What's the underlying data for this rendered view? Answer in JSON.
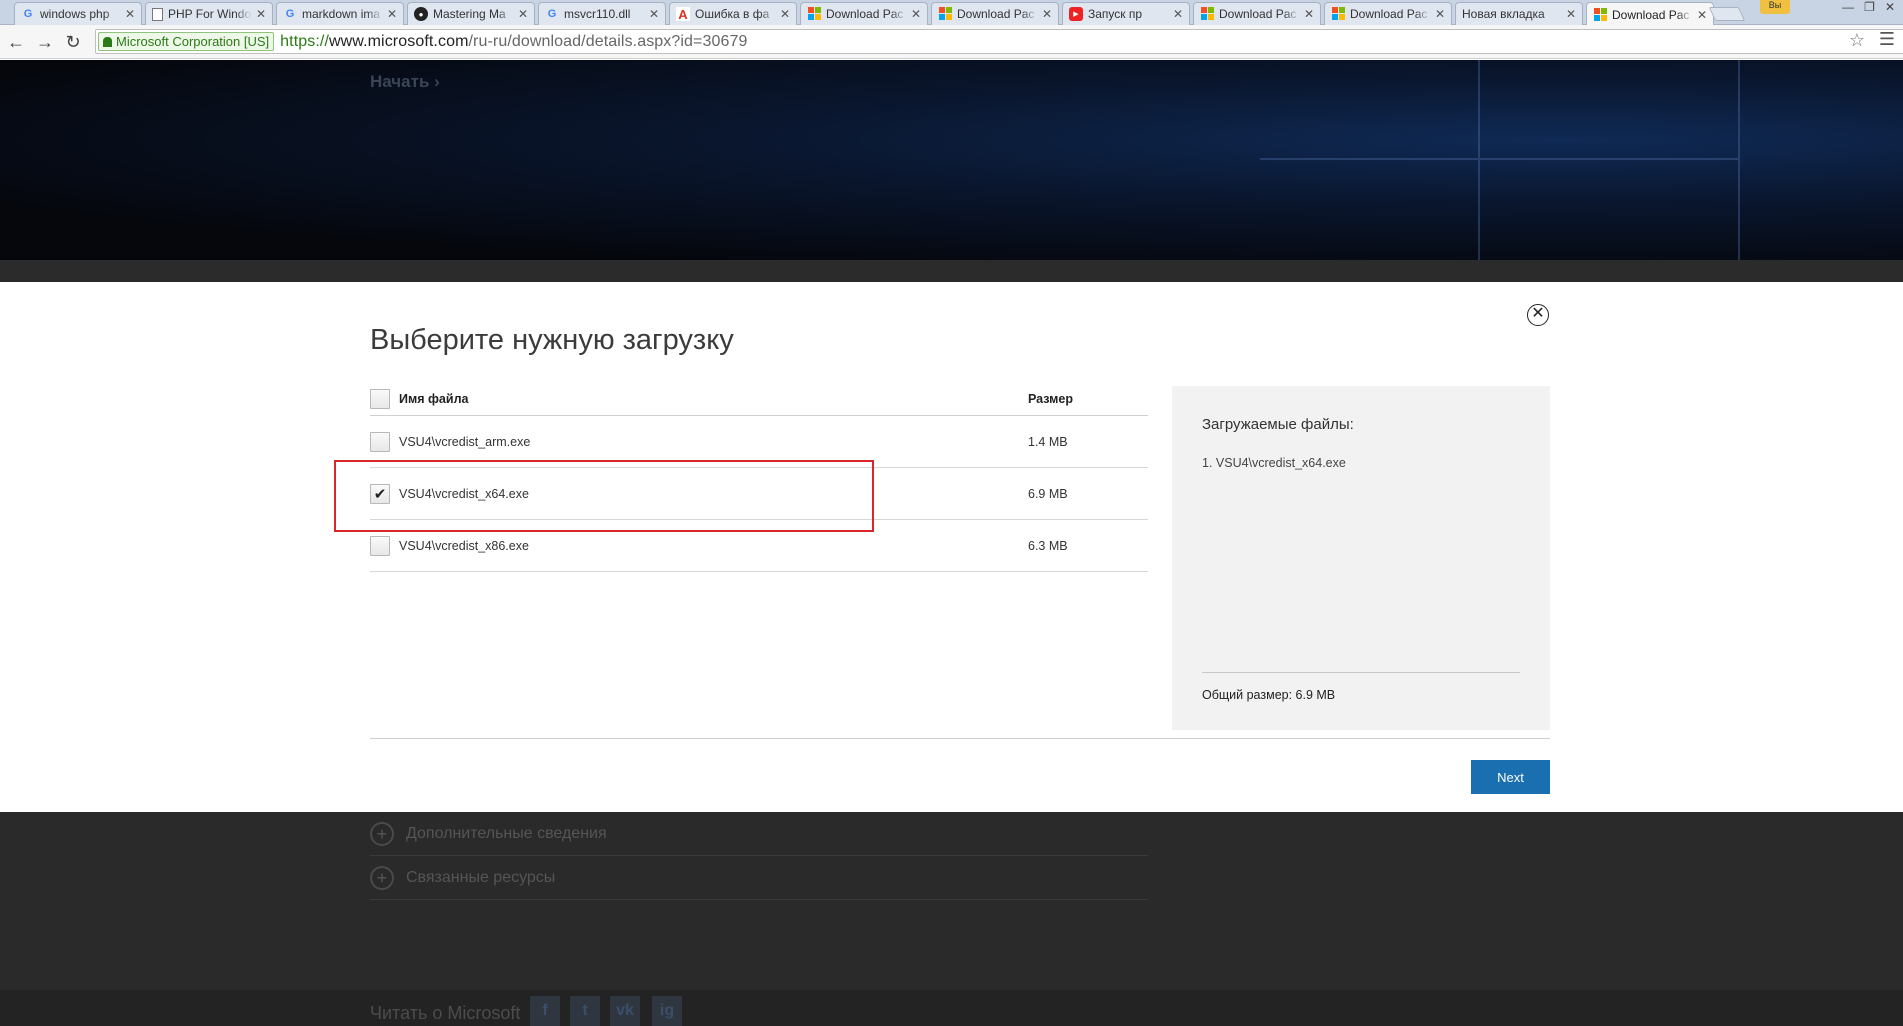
{
  "browser": {
    "tabs": [
      {
        "title": "windows php",
        "favicon": "google-icon",
        "active": false
      },
      {
        "title": "PHP For Windo",
        "favicon": "document-icon",
        "active": false
      },
      {
        "title": "markdown ima",
        "favicon": "google-icon",
        "active": false
      },
      {
        "title": "Mastering Ma",
        "favicon": "github-icon",
        "active": false
      },
      {
        "title": "msvcr110.dll",
        "favicon": "google-icon",
        "active": false
      },
      {
        "title": "Ошибка в фа",
        "favicon": "adobe-icon",
        "active": false
      },
      {
        "title": "Download Pac",
        "favicon": "microsoft-icon",
        "active": false
      },
      {
        "title": "Download Pac",
        "favicon": "microsoft-icon",
        "active": false
      },
      {
        "title": "Запуск пр",
        "favicon": "youtube-icon",
        "active": false
      },
      {
        "title": "Download Pac",
        "favicon": "microsoft-icon",
        "active": false
      },
      {
        "title": "Download Pac",
        "favicon": "microsoft-icon",
        "active": false
      },
      {
        "title": "Новая вкладка",
        "favicon": "none",
        "active": false
      },
      {
        "title": "Download Pac",
        "favicon": "microsoft-icon",
        "active": true
      }
    ],
    "user_badge": "Вы",
    "ev_label": "Microsoft Corporation [US]",
    "url_protocol": "https://",
    "url_host": "www.microsoft.com",
    "url_path": "/ru-ru/download/details.aspx?id=30679"
  },
  "page": {
    "get_started": "Начать ›",
    "more_info": "Дополнительные сведения",
    "related_resources": "Связанные ресурсы",
    "read_about": "Читать о Microsoft",
    "social": [
      "f",
      "t",
      "vk",
      "ig"
    ]
  },
  "dialog": {
    "title": "Выберите нужную загрузку",
    "close_glyph": "✕",
    "columns": {
      "name": "Имя файла",
      "size": "Размер"
    },
    "files": [
      {
        "name": "VSU4\\vcredist_arm.exe",
        "size": "1.4 MB",
        "checked": false
      },
      {
        "name": "VSU4\\vcredist_x64.exe",
        "size": "6.9 MB",
        "checked": true
      },
      {
        "name": "VSU4\\vcredist_x86.exe",
        "size": "6.3 MB",
        "checked": false
      }
    ],
    "summary_title": "Загружаемые файлы:",
    "summary_item": "1. VSU4\\vcredist_x64.exe",
    "summary_total": "Общий размер: 6.9 MB",
    "next_label": "Next"
  },
  "colors": {
    "accent_button": "#1a6fb0",
    "highlight_box": "#d9262b",
    "ev_green": "#2c7a17"
  }
}
